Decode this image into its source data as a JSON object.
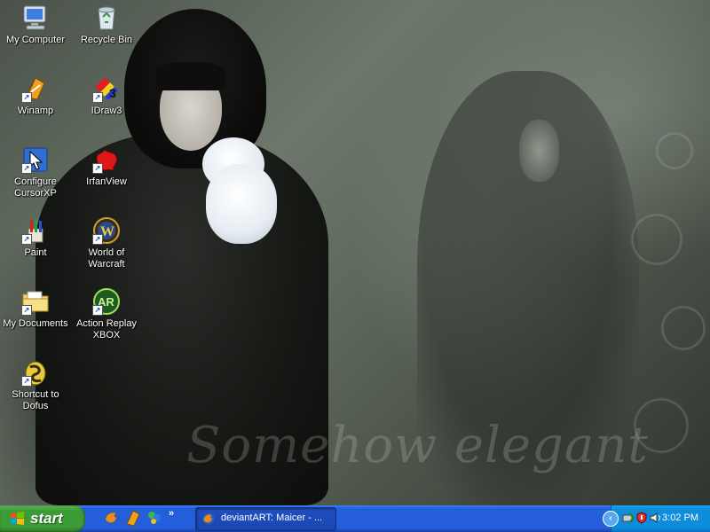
{
  "desktop": {
    "wallpaper_text": "Somehow elegant",
    "icons": [
      {
        "label": "My Computer",
        "icon": "my-computer-icon"
      },
      {
        "label": "Recycle Bin",
        "icon": "recycle-bin-icon"
      },
      {
        "label": "Winamp",
        "icon": "winamp-icon"
      },
      {
        "label": "IDraw3",
        "icon": "idraw3-icon"
      },
      {
        "label": "Configure CursorXP",
        "icon": "cursorxp-icon"
      },
      {
        "label": "IrfanView",
        "icon": "irfanview-icon"
      },
      {
        "label": "Paint",
        "icon": "paint-icon"
      },
      {
        "label": "World of Warcraft",
        "icon": "world-of-warcraft-icon"
      },
      {
        "label": "My Documents",
        "icon": "my-documents-folder-icon"
      },
      {
        "label": "Action Replay XBOX",
        "icon": "action-replay-icon"
      },
      {
        "label": "Shortcut to Dofus",
        "icon": "dofus-icon"
      }
    ]
  },
  "taskbar": {
    "start_label": "start",
    "quick_launch": [
      "firefox-icon",
      "winamp-icon",
      "msn-messenger-icon"
    ],
    "chevron": "»",
    "task": {
      "title": "deviantART: Maicer - ...",
      "icon": "firefox-icon"
    },
    "tray": {
      "expand": "‹",
      "icons": [
        "safely-remove-hardware-icon",
        "security-center-icon",
        "volume-icon"
      ],
      "clock": "3:02 PM"
    }
  },
  "colors": {
    "taskbar_blue": "#245edb",
    "start_green": "#3c9b37",
    "tray_blue": "#0d8ddb"
  }
}
